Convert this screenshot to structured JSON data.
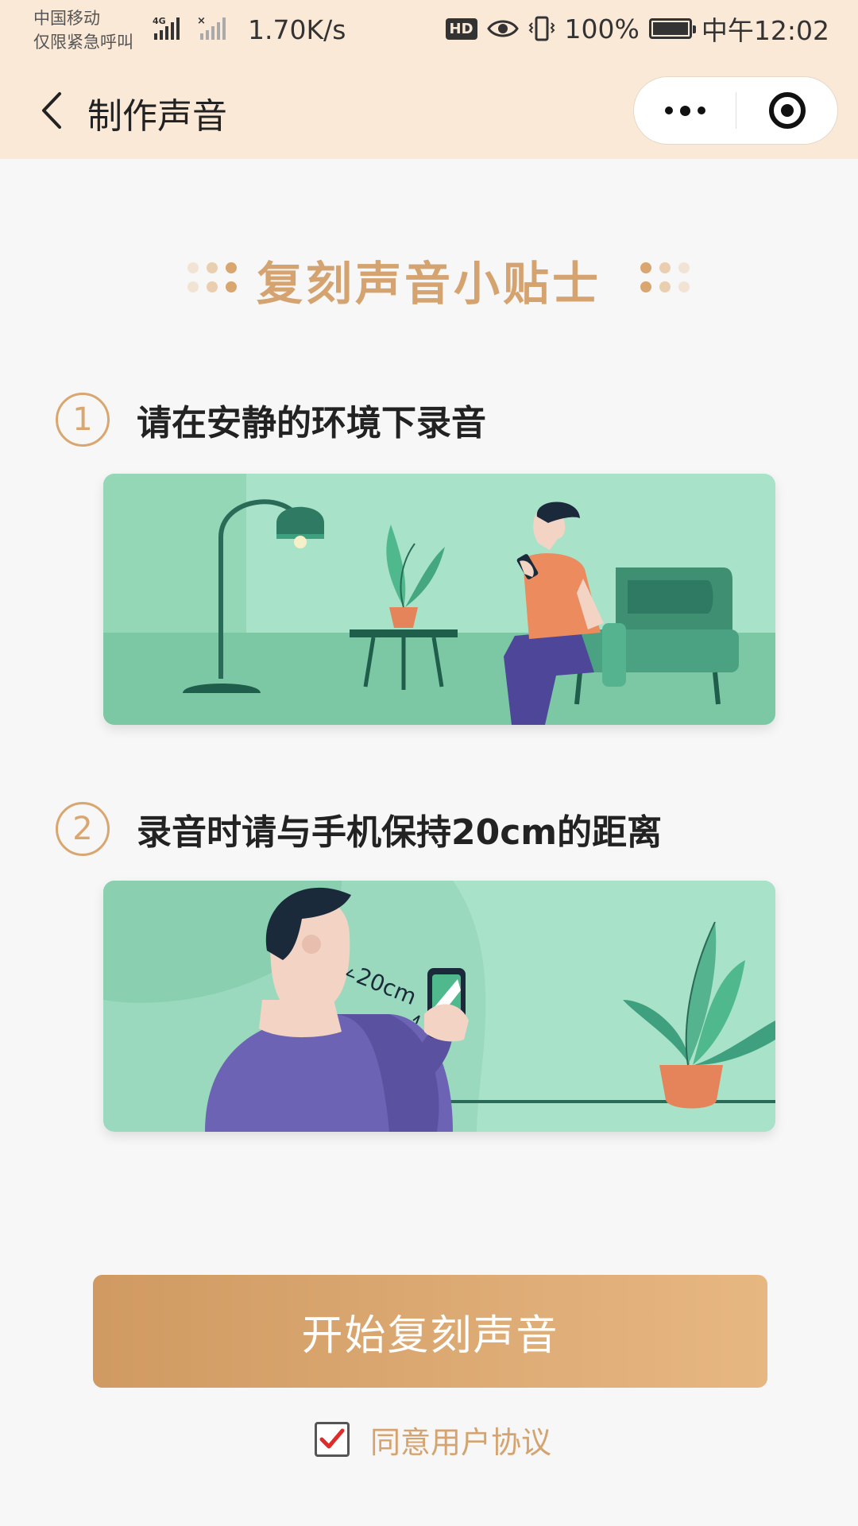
{
  "status_bar": {
    "carrier": "中国移动",
    "emergency": "仅限紧急呼叫",
    "network": "4G",
    "speed": "1.70K/s",
    "hd": "HD",
    "battery": "100%",
    "time": "中午12:02"
  },
  "nav": {
    "title": "制作声音"
  },
  "tips": {
    "title": "复刻声音小贴士",
    "items": [
      {
        "number": "1",
        "text": "请在安静的环境下录音"
      },
      {
        "number": "2",
        "text": "录音时请与手机保持20cm的距离"
      }
    ],
    "distance_label": "20cm"
  },
  "actions": {
    "start_label": "开始复刻声音",
    "agreement_label": "同意用户协议",
    "agreement_checked": true
  },
  "colors": {
    "header_bg": "#fbe9d7",
    "accent_gold": "#d4a36f",
    "button_start": "#d09a62",
    "button_end": "#e7b782",
    "illustration_green": "#8fd4b4",
    "check_red": "#e02b2b"
  }
}
